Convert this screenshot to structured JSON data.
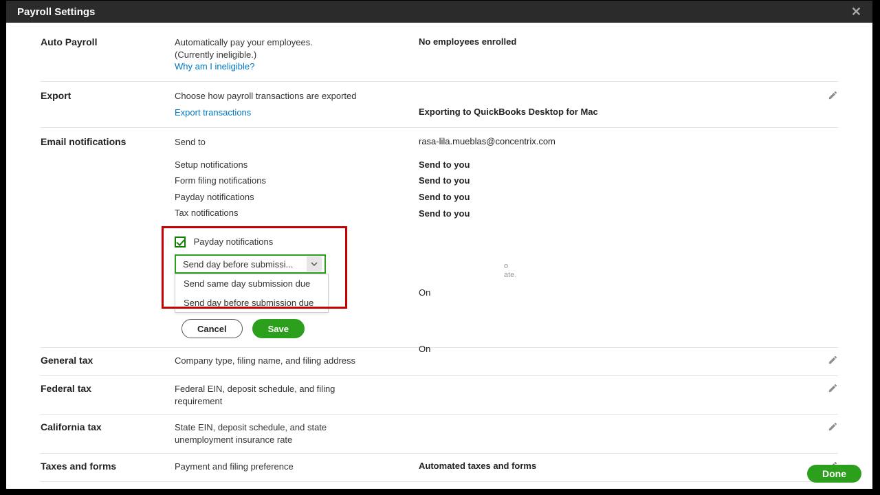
{
  "header": {
    "title": "Payroll Settings"
  },
  "sections": {
    "auto_payroll": {
      "label": "Auto Payroll",
      "desc_line1": "Automatically pay your employees.",
      "desc_line2": "(Currently ineligible.)",
      "link": "Why am I ineligible?",
      "status": "No employees enrolled"
    },
    "export": {
      "label": "Export",
      "desc": "Choose how payroll transactions are exported",
      "link": "Export transactions",
      "status": "Exporting to QuickBooks Desktop for Mac"
    },
    "email": {
      "label": "Email notifications",
      "send_to_label": "Send to",
      "send_to_value": "rasa-lila.mueblas@concentrix.com",
      "rows": [
        {
          "label": "Setup notifications",
          "value": "Send to you"
        },
        {
          "label": "Form filing notifications",
          "value": "Send to you"
        },
        {
          "label": "Payday notifications",
          "value": "Send to you"
        },
        {
          "label": "Tax notifications",
          "value": "Send to you"
        }
      ],
      "checkbox_label": "Payday notifications",
      "checkbox_status": "On",
      "select_value": "Send day before submissi...",
      "options": [
        "Send same day submission due",
        "Send day before submission due"
      ],
      "hidden_tail1": "o",
      "hidden_tail2": "ate.",
      "second_on": "On",
      "cancel": "Cancel",
      "save": "Save"
    },
    "general_tax": {
      "label": "General tax",
      "desc": "Company type, filing name, and filing address"
    },
    "federal_tax": {
      "label": "Federal tax",
      "desc": "Federal EIN, deposit schedule, and filing requirement"
    },
    "california_tax": {
      "label": "California tax",
      "desc": "State EIN, deposit schedule, and state unemployment insurance rate"
    },
    "taxes_forms": {
      "label": "Taxes and forms",
      "desc": "Payment and filing preference",
      "value": "Automated taxes and forms"
    }
  },
  "footer": {
    "done": "Done"
  }
}
